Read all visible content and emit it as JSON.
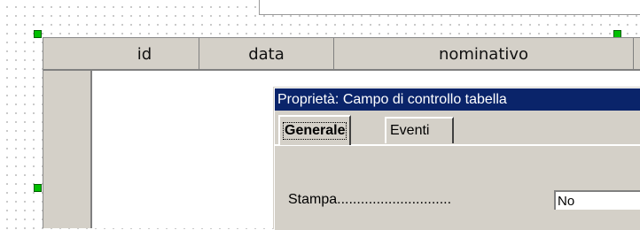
{
  "grid": {
    "columns": [
      "id",
      "data",
      "nominativo"
    ]
  },
  "dialog": {
    "title": "Proprietà:  Campo di controllo tabella",
    "tabs": [
      "Generale",
      "Eventi"
    ],
    "properties": [
      {
        "label": "Stampa.............................",
        "value": "No"
      }
    ]
  },
  "colors": {
    "selection_handle": "#00c000",
    "titlebar": "#0a246a",
    "face": "#d4d0c8"
  }
}
